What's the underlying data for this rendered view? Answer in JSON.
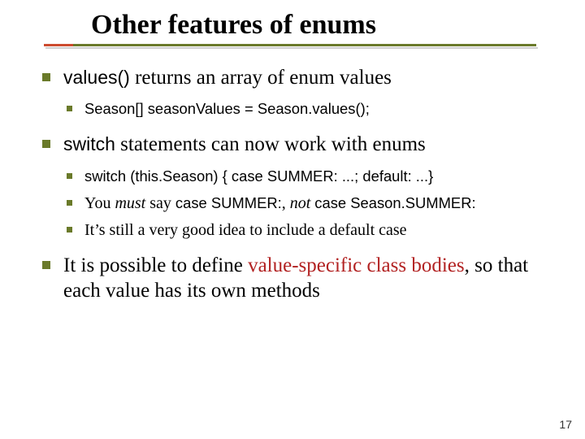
{
  "title": "Other features of enums",
  "b1": {
    "prefix_code": "values()",
    "text": " returns an array of enum values",
    "sub": {
      "s1": "Season[] seasonValues = Season.values();"
    }
  },
  "b2": {
    "prefix_code": "switch",
    "text": " statements can now work with enums",
    "sub": {
      "s1": "switch (this.Season) { case SUMMER: ...; default: ...}",
      "s2a": "You ",
      "s2b": "must",
      "s2c": " say ",
      "s2d": "case SUMMER:",
      "s2e": ", ",
      "s2f": "not",
      "s2g": " ",
      "s2h": "case Season.SUMMER:",
      "s3": "It’s still a very good idea to include a default case"
    }
  },
  "b3": {
    "a": "It is possible to define ",
    "b": "value-specific class bodies",
    "c": ", so that each value has its own methods"
  },
  "page": "17"
}
